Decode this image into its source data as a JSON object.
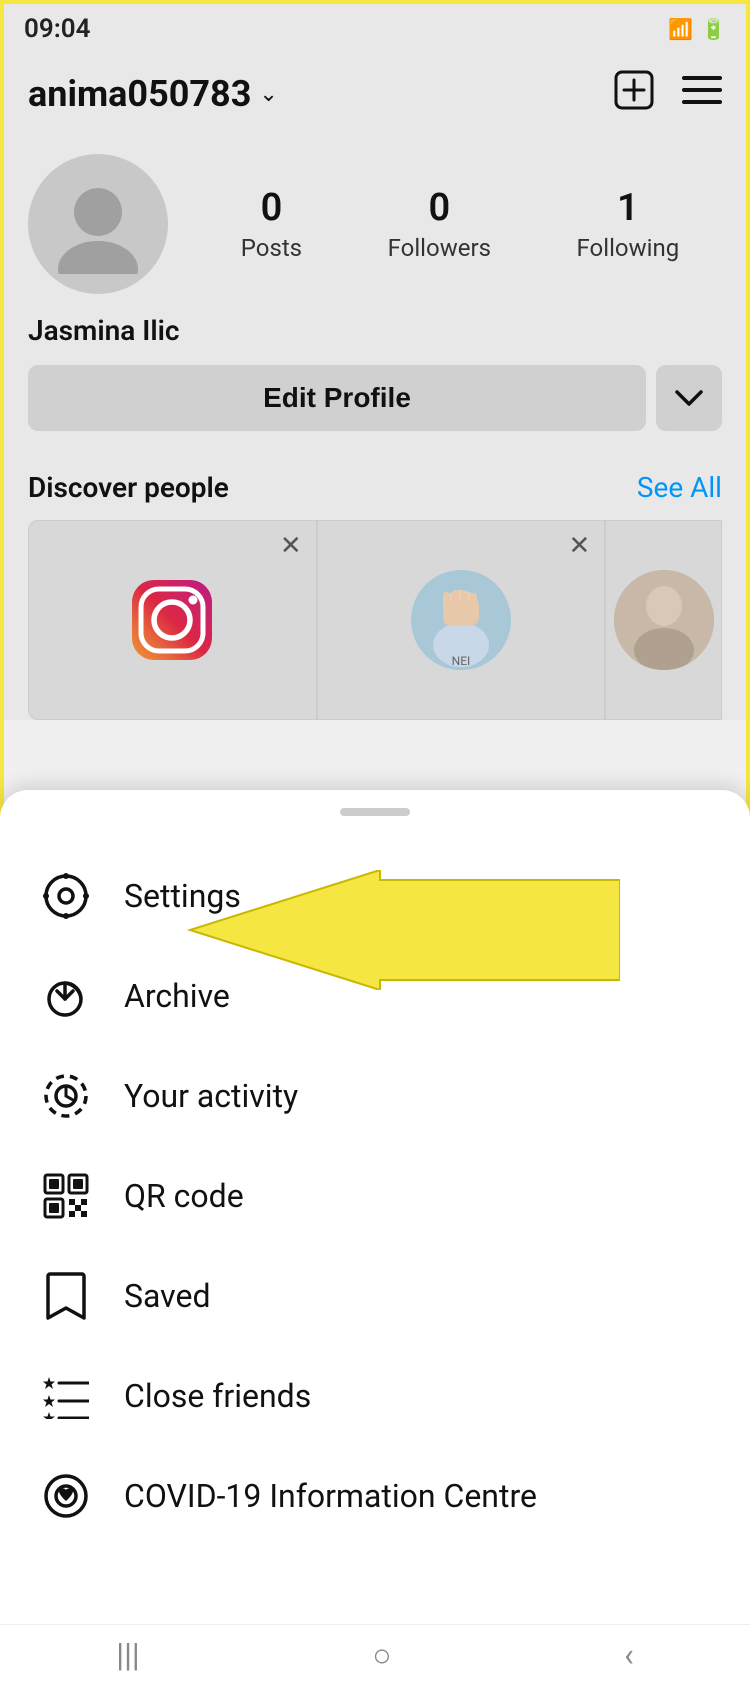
{
  "statusBar": {
    "time": "09:04",
    "icons": "▾ ▮▮ 🔋"
  },
  "topNav": {
    "username": "anima050783",
    "dropdownSymbol": "⌄",
    "addIcon": "⊕",
    "menuIcon": "≡"
  },
  "profile": {
    "displayName": "Jasmina Ilic",
    "stats": [
      {
        "count": "0",
        "label": "Posts"
      },
      {
        "count": "0",
        "label": "Followers"
      },
      {
        "count": "1",
        "label": "Following"
      }
    ],
    "editProfileLabel": "Edit Profile",
    "dropdownLabel": "⌄"
  },
  "discover": {
    "title": "Discover people",
    "seeAllLabel": "See All"
  },
  "menu": {
    "handleLabel": "",
    "items": [
      {
        "id": "settings",
        "label": "Settings"
      },
      {
        "id": "archive",
        "label": "Archive"
      },
      {
        "id": "your-activity",
        "label": "Your activity"
      },
      {
        "id": "qr-code",
        "label": "QR code"
      },
      {
        "id": "saved",
        "label": "Saved"
      },
      {
        "id": "close-friends",
        "label": "Close friends"
      },
      {
        "id": "covid",
        "label": "COVID-19 Information Centre"
      }
    ]
  },
  "bottomNav": {
    "items": [
      "|||",
      "○",
      "<"
    ]
  }
}
